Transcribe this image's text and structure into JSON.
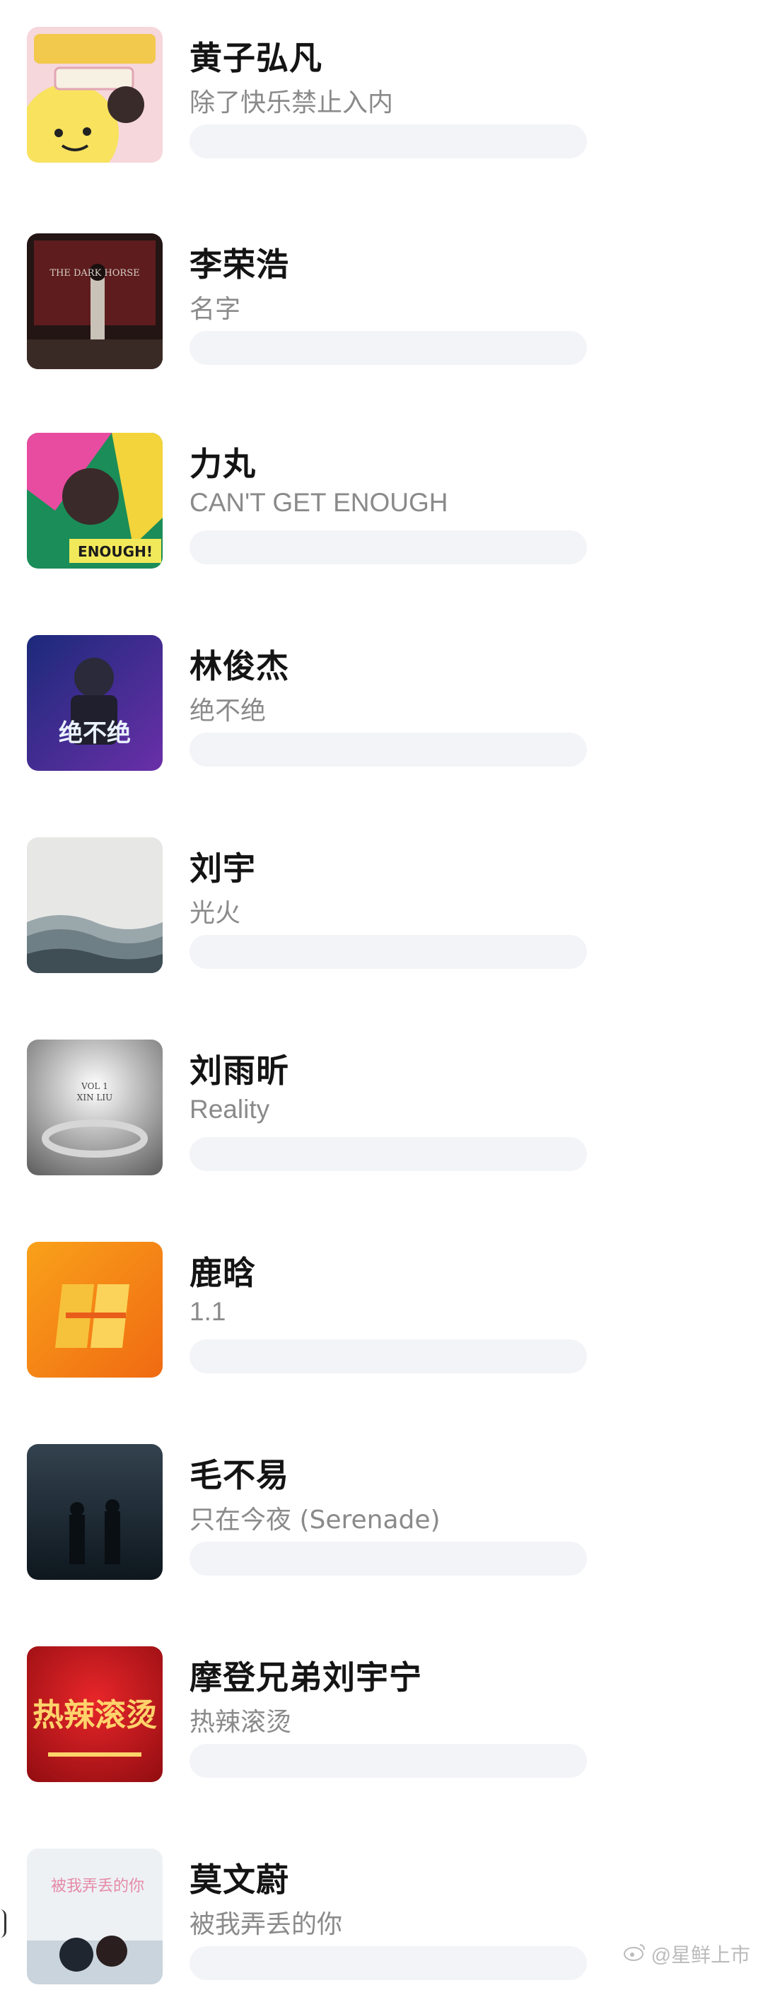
{
  "items": [
    {
      "artist": "黄子弘凡",
      "song": "除了快乐禁止入内",
      "colors": [
        "#f9e36a",
        "#f5d1d9"
      ]
    },
    {
      "artist": "李荣浩",
      "song": "名字",
      "colors": [
        "#2b1816",
        "#8c2a2a"
      ]
    },
    {
      "artist": "力丸",
      "song": "CAN'T GET ENOUGH",
      "colors": [
        "#1c8c5a",
        "#e84ca0"
      ]
    },
    {
      "artist": "林俊杰",
      "song": "绝不绝",
      "colors": [
        "#1e2a78",
        "#6b2fa6"
      ]
    },
    {
      "artist": "刘宇",
      "song": "光火",
      "colors": [
        "#e6e6e6",
        "#7c8d93"
      ]
    },
    {
      "artist": "刘雨昕",
      "song": "Reality",
      "colors": [
        "#f4f4f4",
        "#6c6c6c"
      ]
    },
    {
      "artist": "鹿晗",
      "song": "1.1",
      "colors": [
        "#f58a12",
        "#f2b318"
      ]
    },
    {
      "artist": "毛不易",
      "song": "只在今夜 (Serenade)",
      "colors": [
        "#2c3946",
        "#0f1820"
      ]
    },
    {
      "artist": "摩登兄弟刘宇宁",
      "song": "热辣滚烫",
      "colors": [
        "#c81318",
        "#f0b34a"
      ]
    },
    {
      "artist": "莫文蔚",
      "song": "被我弄丢的你",
      "colors": [
        "#eef0f2",
        "#c9d3db"
      ]
    }
  ],
  "watermark": {
    "text": "@星鲜上市",
    "icon": "weibo-icon"
  }
}
